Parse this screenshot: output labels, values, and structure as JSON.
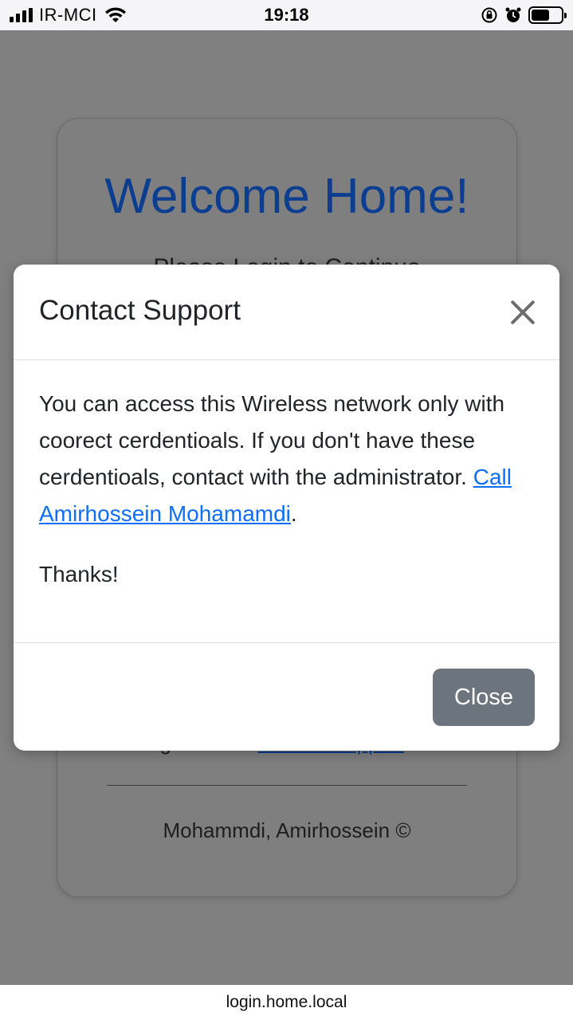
{
  "status_bar": {
    "carrier": "IR-MCI",
    "time": "19:18",
    "battery_level": 0.6
  },
  "background_card": {
    "title": "Welcome Home!",
    "subtitle_partial": "Please Login to Continue",
    "trouble_text": "Having trouble?",
    "trouble_link": "Contact support",
    "footer": "Mohammdi, Amirhossein ©"
  },
  "modal": {
    "title": "Contact Support",
    "body_text": "You can access this Wireless network only with coorect cerdentioals. If you don't have these cerdentioals, contact with the administrator.",
    "body_link": "Call Amirhossein Mohamamdi",
    "body_end": ".",
    "thanks": "Thanks!",
    "close_label": "Close"
  },
  "url_bar": {
    "url": "login.home.local"
  },
  "colors": {
    "title_blue": "#0b3d91",
    "link_blue": "#0d6efd",
    "button_gray": "#6c757d"
  }
}
